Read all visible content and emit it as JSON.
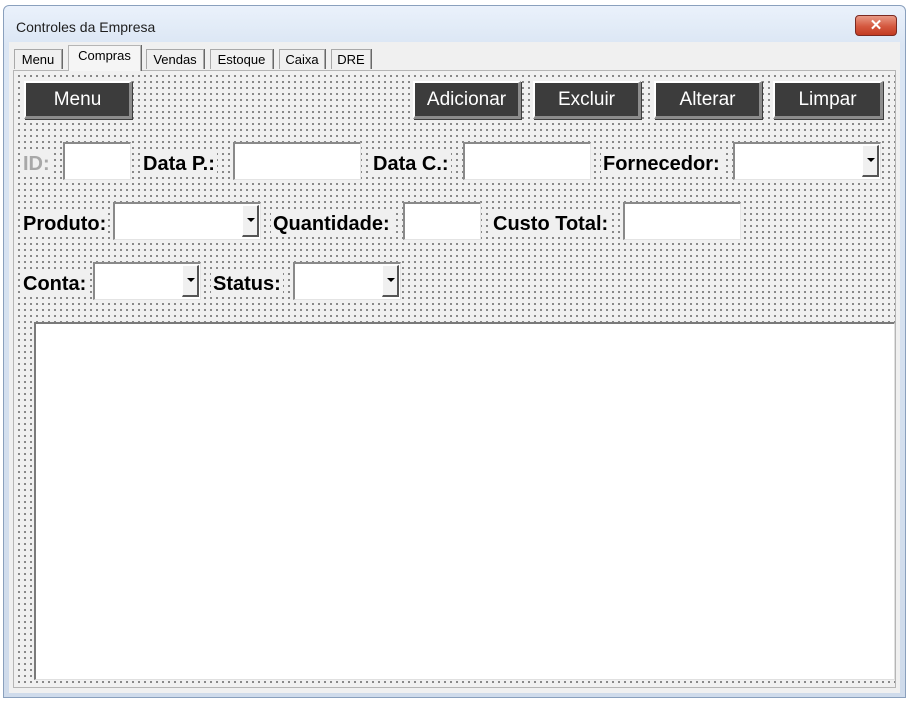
{
  "window": {
    "title": "Controles da Empresa",
    "close_label": "✕"
  },
  "tabs": [
    {
      "label": "Menu"
    },
    {
      "label": "Compras"
    },
    {
      "label": "Vendas"
    },
    {
      "label": "Estoque"
    },
    {
      "label": "Caixa"
    },
    {
      "label": "DRE"
    }
  ],
  "active_tab": "Compras",
  "toolbar": {
    "menu_label": "Menu",
    "adicionar_label": "Adicionar",
    "excluir_label": "Excluir",
    "alterar_label": "Alterar",
    "limpar_label": "Limpar"
  },
  "form": {
    "id_label": "ID:",
    "id_value": "",
    "data_p_label": "Data P.:",
    "data_p_value": "",
    "data_c_label": "Data C.:",
    "data_c_value": "",
    "fornecedor_label": "Fornecedor:",
    "fornecedor_value": "",
    "produto_label": "Produto:",
    "produto_value": "",
    "quantidade_label": "Quantidade:",
    "quantidade_value": "",
    "custo_total_label": "Custo Total:",
    "custo_total_value": "",
    "conta_label": "Conta:",
    "conta_value": "",
    "status_label": "Status:",
    "status_value": ""
  },
  "colors": {
    "button_bg": "#3c3c3c",
    "button_text": "#ffffff",
    "close_button": "#c8452c",
    "disabled_label": "#a8a8a8"
  }
}
